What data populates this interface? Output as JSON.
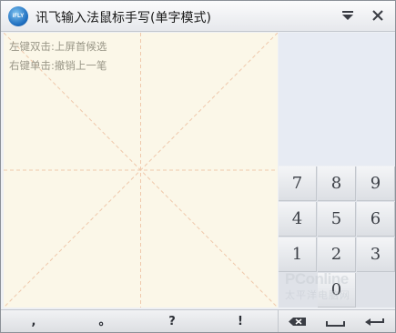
{
  "titlebar": {
    "logo_text": "iFLY",
    "title": "讯飞输入法鼠标手写(单字模式)",
    "menu_icon": "triangle-down-menu-icon",
    "close_icon": "close-icon"
  },
  "canvas": {
    "hint_double_click": "左键双击:上屏首候选",
    "hint_right_click": "右键单击:撤销上一笔",
    "guide_color": "#f0c8a8",
    "background": "#fbf7e8"
  },
  "keypad": {
    "keys": [
      "7",
      "8",
      "9",
      "4",
      "5",
      "6",
      "1",
      "2",
      "3",
      "0"
    ]
  },
  "punctuation": [
    ",",
    "。",
    "?",
    "!"
  ],
  "bottom_icons": [
    "backspace-icon",
    "space-icon",
    "enter-icon"
  ],
  "watermark": {
    "brand": "PConline",
    "subtitle": "太平洋电脑网"
  }
}
